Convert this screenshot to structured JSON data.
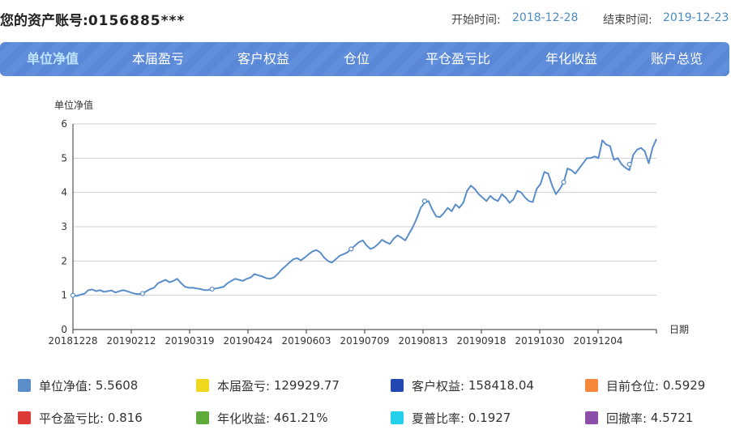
{
  "header": {
    "account_prefix": "您的资产账号:",
    "account_number": "0156885***",
    "start_label": "开始时间:",
    "start_date": "2018-12-28",
    "end_label": "结束时间:",
    "end_date": "2019-12-23"
  },
  "tabs": [
    {
      "label": "单位净值",
      "active": true
    },
    {
      "label": "本届盈亏"
    },
    {
      "label": "客户权益"
    },
    {
      "label": "仓位"
    },
    {
      "label": "平仓盈亏比"
    },
    {
      "label": "年化收益"
    },
    {
      "label": "账户总览"
    }
  ],
  "chart_data": {
    "type": "line",
    "ylabel": "单位净值",
    "xlabel": "日期",
    "ylim": [
      0,
      6
    ],
    "yticks": [
      "0",
      "1",
      "2",
      "3",
      "4",
      "5",
      "6"
    ],
    "grid": true,
    "xtick_labels": [
      "20181228",
      "20190212",
      "20190319",
      "20190424",
      "20190603",
      "20190709",
      "20190813",
      "20190918",
      "20191030",
      "20191204"
    ],
    "series": [
      {
        "name": "单位净值",
        "color": "#5b8ec9",
        "values": [
          1.0,
          0.98,
          1.02,
          1.05,
          1.15,
          1.17,
          1.12,
          1.15,
          1.1,
          1.12,
          1.14,
          1.08,
          1.12,
          1.15,
          1.12,
          1.08,
          1.05,
          1.03,
          1.05,
          1.12,
          1.18,
          1.22,
          1.35,
          1.4,
          1.45,
          1.38,
          1.42,
          1.48,
          1.35,
          1.25,
          1.22,
          1.22,
          1.2,
          1.18,
          1.15,
          1.15,
          1.18,
          1.2,
          1.22,
          1.25,
          1.35,
          1.42,
          1.48,
          1.45,
          1.42,
          1.48,
          1.52,
          1.62,
          1.58,
          1.55,
          1.5,
          1.48,
          1.52,
          1.62,
          1.75,
          1.85,
          1.95,
          2.05,
          2.08,
          2.02,
          2.1,
          2.2,
          2.28,
          2.32,
          2.25,
          2.1,
          2.0,
          1.95,
          2.05,
          2.15,
          2.2,
          2.25,
          2.35,
          2.45,
          2.55,
          2.6,
          2.45,
          2.35,
          2.4,
          2.5,
          2.62,
          2.55,
          2.5,
          2.65,
          2.75,
          2.68,
          2.6,
          2.8,
          3.0,
          3.25,
          3.55,
          3.7,
          3.75,
          3.5,
          3.3,
          3.28,
          3.4,
          3.55,
          3.45,
          3.65,
          3.55,
          3.7,
          4.05,
          4.2,
          4.1,
          3.95,
          3.85,
          3.75,
          3.9,
          3.8,
          3.75,
          3.95,
          3.85,
          3.7,
          3.8,
          4.05,
          4.0,
          3.85,
          3.75,
          3.72,
          4.1,
          4.25,
          4.6,
          4.55,
          4.2,
          3.95,
          4.1,
          4.3,
          4.7,
          4.65,
          4.55,
          4.7,
          4.85,
          5.0,
          5.0,
          5.05,
          5.0,
          5.52,
          5.4,
          5.35,
          4.95,
          5.0,
          4.82,
          4.72,
          4.65,
          5.1,
          5.25,
          5.3,
          5.2,
          4.85,
          5.3,
          5.56
        ]
      }
    ],
    "markers": [
      {
        "x_index": 0,
        "value": 1.0
      },
      {
        "x_index": 18,
        "value": 1.05
      },
      {
        "x_index": 36,
        "value": 1.18
      },
      {
        "x_index": 72,
        "value": 2.35
      },
      {
        "x_index": 91,
        "value": 3.75
      },
      {
        "x_index": 127,
        "value": 4.3
      },
      {
        "x_index": 144,
        "value": 4.82
      }
    ]
  },
  "legend": [
    {
      "key": "nav",
      "label": "单位净值:",
      "value": "5.5608",
      "color": "#5b8ec9"
    },
    {
      "key": "pnl",
      "label": "本届盈亏:",
      "value": "129929.77",
      "color": "#f0d81f"
    },
    {
      "key": "equity",
      "label": "客户权益:",
      "value": "158418.04",
      "color": "#2348b3"
    },
    {
      "key": "position",
      "label": "目前仓位:",
      "value": "0.5929",
      "color": "#f5883a"
    },
    {
      "key": "closed_ratio",
      "label": "平仓盈亏比:",
      "value": "0.816",
      "color": "#dd3a36"
    },
    {
      "key": "annual",
      "label": "年化收益:",
      "value": "461.21%",
      "color": "#5fab3a"
    },
    {
      "key": "sharpe",
      "label": "夏普比率:",
      "value": "0.1927",
      "color": "#24d0ea"
    },
    {
      "key": "drawdown",
      "label": "回撤率:",
      "value": "4.5721",
      "color": "#8b4fa9"
    }
  ]
}
